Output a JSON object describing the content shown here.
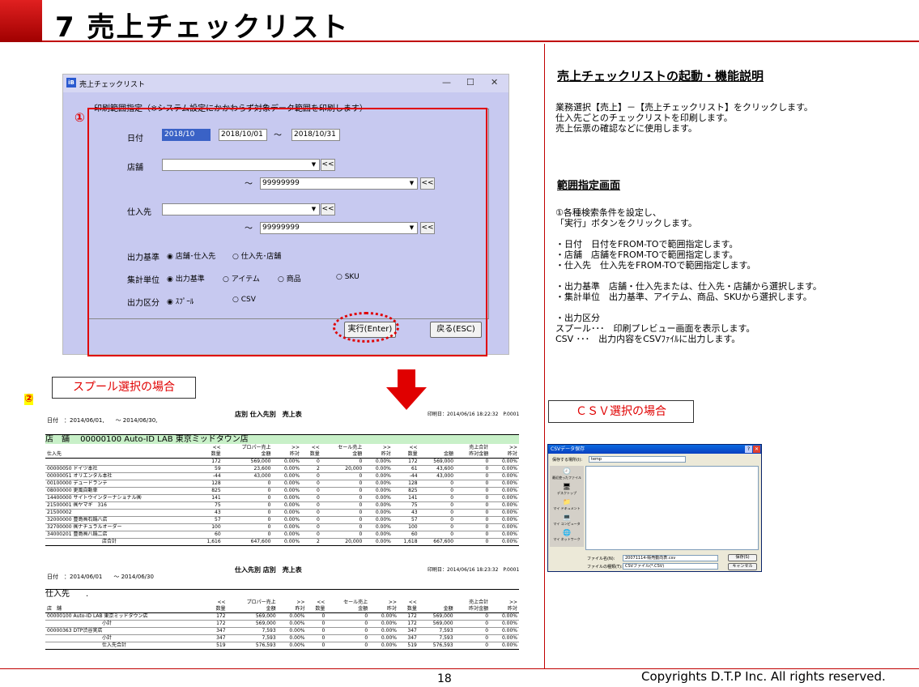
{
  "page": {
    "title": "7 売上チェックリスト",
    "page_number": "18",
    "copyright": "Copyrights D.T.P Inc. All rights reserved."
  },
  "dialog": {
    "title": "売上チェックリスト",
    "group_label": "印刷範囲指定（※システム設定にかかわらず対象データ範囲を印刷します）",
    "date_label": "日付",
    "date_value": "2018/10",
    "date_from": "2018/10/01",
    "tilde": "～",
    "date_to": "2018/10/31",
    "store_label": "店舗",
    "store_to": "99999999",
    "supplier_label": "仕入先",
    "supplier_to": "99999999",
    "btn_back": "<<",
    "output_basis_label": "出力基準",
    "output_basis_opt1": "店舗･仕入先",
    "output_basis_opt2": "仕入先･店舗",
    "agg_label": "集計単位",
    "agg_opt1": "出力基準",
    "agg_opt2": "アイテム",
    "agg_opt3": "商品",
    "agg_opt4": "SKU",
    "out_label": "出力区分",
    "out_opt1": "ｽﾌﾟｰﾙ",
    "out_opt2": "CSV",
    "exec_button": "実行(Enter)",
    "back_button": "戻る(ESC)"
  },
  "markers": {
    "one": "①",
    "two": "②"
  },
  "callouts": {
    "spool": "スプール選択の場合",
    "csv": "ＣＳＶ選択の場合"
  },
  "right": {
    "h1": "売上チェックリストの起動・機能説明",
    "p1": "業務選択【売上】－【売上チェックリスト】をクリックします。\n仕入先ごとのチェックリストを印刷します。\n売上伝票の確認などに使用します。",
    "h2": "範囲指定画面",
    "p2": "①各種検索条件を設定し、\n「実行」ボタンをクリックします。\n\n・日付　日付をFROM-TOで範囲指定します。\n・店舗　店舗をFROM-TOで範囲指定します。\n・仕入先　仕入先をFROM-TOで範囲指定します。\n\n・出力基準　店舗・仕入先または、仕入先・店舗から選択します。\n・集計単位　出力基準、アイテム、商品、SKUから選択します。\n\n・出力区分\nスプール･･･　印刷プレビュー画面を表示します。\nCSV ･･･　出力内容をCSVﾌｧｲﾙに出力します。"
  },
  "report1": {
    "title": "店別 仕入先別　売上表",
    "date": "日付　：2014/06/01,　　～ 2014/06/30,",
    "printed": "印刷日：2014/06/16 18:22:32　P.0001",
    "store": "店　舗　 00000100 Auto-ID LAB 東京ミッドタウン店",
    "headers1": [
      "<<",
      "プロパー売上",
      ">>",
      "<<",
      "セール売上",
      ">>",
      "<<",
      "売上合計",
      ">>"
    ],
    "headers2": [
      "仕入先",
      "数量",
      "金額",
      "昨対",
      "数量",
      "金額",
      "昨対",
      "数量",
      "金額",
      "昨対金額",
      "昨対"
    ],
    "rows": [
      [
        "",
        "172",
        "569,000",
        "0.00%",
        "0",
        "0",
        "0.00%",
        "172",
        "569,000",
        "0",
        "0.00%"
      ],
      [
        "00000050 ドイツ本社",
        "59",
        "23,600",
        "0.00%",
        "2",
        "20,000",
        "0.00%",
        "61",
        "43,600",
        "0",
        "0.00%"
      ],
      [
        "00000051 オリエンタル本社",
        "-44",
        "43,000",
        "0.00%",
        "0",
        "0",
        "0.00%",
        "-44",
        "43,000",
        "0",
        "0.00%"
      ],
      [
        "00100000 デュードランテ",
        "128",
        "0",
        "0.00%",
        "0",
        "0",
        "0.00%",
        "128",
        "0",
        "0",
        "0.00%"
      ],
      [
        "08000000 更風自動車",
        "825",
        "0",
        "0.00%",
        "0",
        "0",
        "0.00%",
        "825",
        "0",
        "0",
        "0.00%"
      ],
      [
        "14400000 サイトウインターナショナル㈱",
        "141",
        "0",
        "0.00%",
        "0",
        "0",
        "0.00%",
        "141",
        "0",
        "0",
        "0.00%"
      ],
      [
        "21500001 ㈱ヤマギ　316",
        "75",
        "0",
        "0.00%",
        "0",
        "0",
        "0.00%",
        "75",
        "0",
        "0",
        "0.00%"
      ],
      [
        "21500002",
        "43",
        "0",
        "0.00%",
        "0",
        "0",
        "0.00%",
        "43",
        "0",
        "0",
        "0.00%"
      ],
      [
        "32000000 豊島㈱石鍋八店",
        "57",
        "0",
        "0.00%",
        "0",
        "0",
        "0.00%",
        "57",
        "0",
        "0",
        "0.00%"
      ],
      [
        "32700000 ㈱ナチュラルオーダー",
        "100",
        "0",
        "0.00%",
        "0",
        "0",
        "0.00%",
        "100",
        "0",
        "0",
        "0.00%"
      ],
      [
        "34000201 豊島㈱八鍋二店",
        "60",
        "0",
        "0.00%",
        "0",
        "0",
        "0.00%",
        "60",
        "0",
        "0",
        "0.00%"
      ],
      [
        "店合計",
        "1,616",
        "647,600",
        "0.00%",
        "2",
        "20,000",
        "0.00%",
        "1,618",
        "667,600",
        "0",
        "0.00%"
      ]
    ]
  },
  "report2": {
    "title": "仕入先別 店別　売上表",
    "date": "日付　：2014/06/01　　～ 2014/06/30",
    "printed": "印刷日：2014/06/16 18:23:32　P.0001",
    "supplier": "仕入先　　.",
    "headers1": [
      "<<",
      "プロパー売上",
      ">>",
      "<<",
      "セール売上",
      ">>",
      "<<",
      "売上合計",
      ">>"
    ],
    "headers2": [
      "店　舗",
      "数量",
      "金額",
      "昨対",
      "数量",
      "金額",
      "昨対",
      "数量",
      "金額",
      "昨対金額",
      "昨対"
    ],
    "rows": [
      [
        "00000100 Auto-ID LAB 東京ミッドタウン店",
        "172",
        "569,000",
        "0.00%",
        "0",
        "0",
        "0.00%",
        "172",
        "569,000",
        "0",
        "0.00%"
      ],
      [
        "小計",
        "172",
        "569,000",
        "0.00%",
        "0",
        "0",
        "0.00%",
        "172",
        "569,000",
        "0",
        "0.00%"
      ],
      [
        "00000363 DTP渋谷実店",
        "347",
        "7,593",
        "0.00%",
        "0",
        "0",
        "0.00%",
        "347",
        "7,593",
        "0",
        "0.00%"
      ],
      [
        "小計",
        "347",
        "7,593",
        "0.00%",
        "0",
        "0",
        "0.00%",
        "347",
        "7,593",
        "0",
        "0.00%"
      ],
      [
        "仕入先合計",
        "519",
        "576,593",
        "0.00%",
        "0",
        "0",
        "0.00%",
        "519",
        "576,593",
        "0",
        "0.00%"
      ]
    ]
  },
  "csv_dialog": {
    "title": "CSVデータ保存",
    "save_in_label": "保存する場所(I):",
    "save_in_value": "temp",
    "places": [
      "最近使ったファイル",
      "デスクトップ",
      "マイ ドキュメント",
      "マイ コンピュータ",
      "マイ ネットワーク"
    ],
    "filename_label": "ファイル名(N):",
    "filename_value": "20071114-販売動向表.csv",
    "filetype_label": "ファイルの種類(T):",
    "filetype_value": "CSVファイル(*.CSV)",
    "save_button": "保存(S)",
    "cancel_button": "キャンセル"
  }
}
